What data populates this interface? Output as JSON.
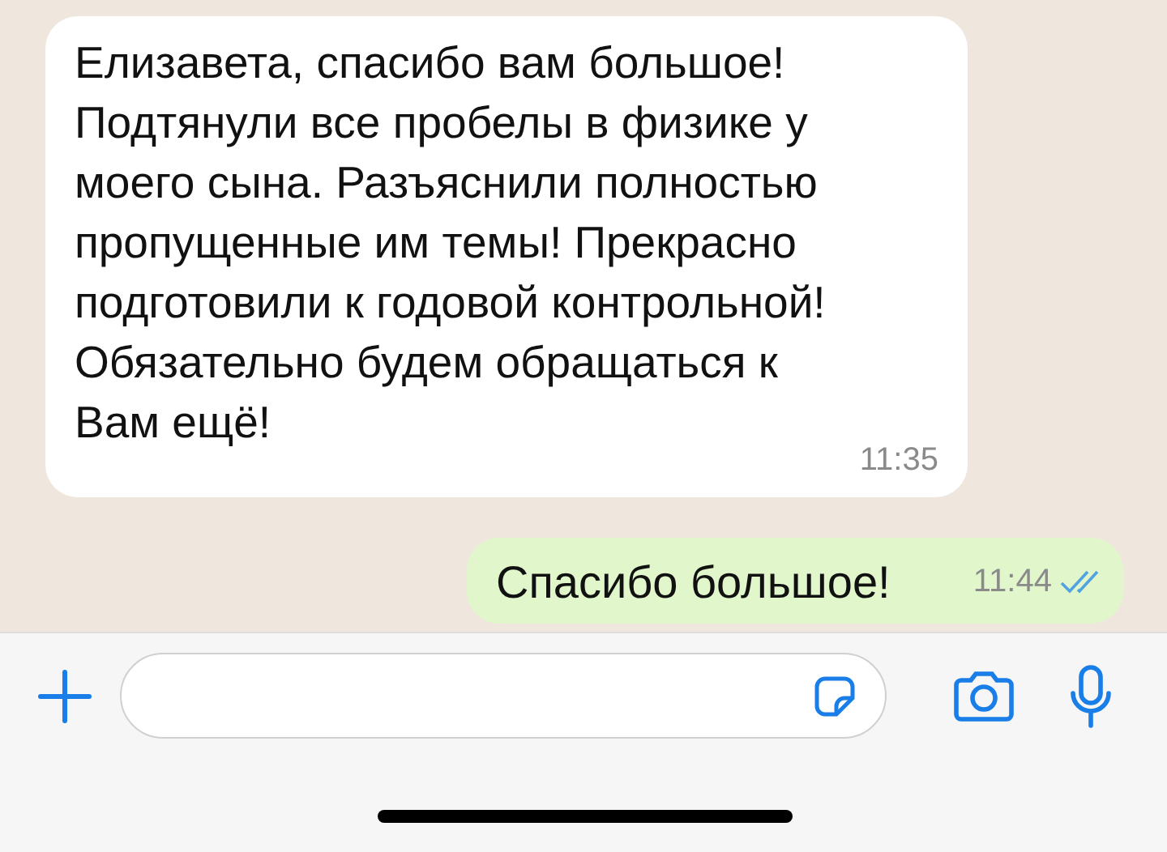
{
  "messages": [
    {
      "kind": "incoming",
      "text": "Елизавета, спасибо вам большое!\nПодтянули все пробелы в физике у\nмоего сына. Разъяснили полностью\nпропущенные им темы! Прекрасно\nподготовили к годовой контрольной!\nОбязательно будем обращаться к\nВам ещё!",
      "time": "11:35"
    },
    {
      "kind": "outgoing",
      "text": "Спасибо большое!",
      "time": "11:44",
      "read": true
    }
  ]
}
